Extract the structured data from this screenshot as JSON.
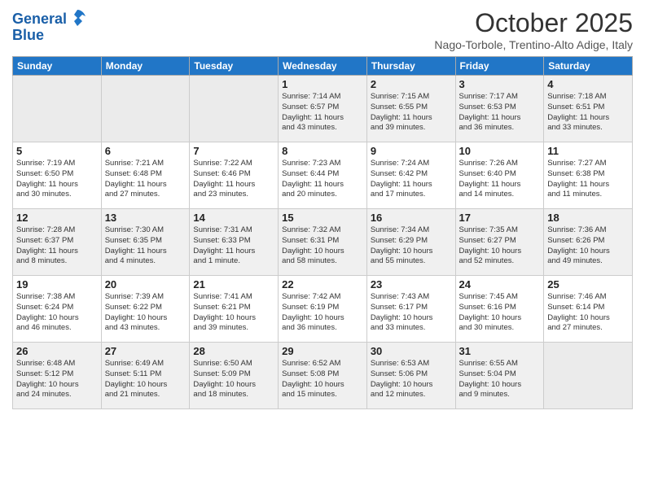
{
  "header": {
    "logo_line1": "General",
    "logo_line2": "Blue",
    "month": "October 2025",
    "location": "Nago-Torbole, Trentino-Alto Adige, Italy"
  },
  "days_of_week": [
    "Sunday",
    "Monday",
    "Tuesday",
    "Wednesday",
    "Thursday",
    "Friday",
    "Saturday"
  ],
  "weeks": [
    [
      {
        "day": "",
        "info": ""
      },
      {
        "day": "",
        "info": ""
      },
      {
        "day": "",
        "info": ""
      },
      {
        "day": "1",
        "info": "Sunrise: 7:14 AM\nSunset: 6:57 PM\nDaylight: 11 hours\nand 43 minutes."
      },
      {
        "day": "2",
        "info": "Sunrise: 7:15 AM\nSunset: 6:55 PM\nDaylight: 11 hours\nand 39 minutes."
      },
      {
        "day": "3",
        "info": "Sunrise: 7:17 AM\nSunset: 6:53 PM\nDaylight: 11 hours\nand 36 minutes."
      },
      {
        "day": "4",
        "info": "Sunrise: 7:18 AM\nSunset: 6:51 PM\nDaylight: 11 hours\nand 33 minutes."
      }
    ],
    [
      {
        "day": "5",
        "info": "Sunrise: 7:19 AM\nSunset: 6:50 PM\nDaylight: 11 hours\nand 30 minutes."
      },
      {
        "day": "6",
        "info": "Sunrise: 7:21 AM\nSunset: 6:48 PM\nDaylight: 11 hours\nand 27 minutes."
      },
      {
        "day": "7",
        "info": "Sunrise: 7:22 AM\nSunset: 6:46 PM\nDaylight: 11 hours\nand 23 minutes."
      },
      {
        "day": "8",
        "info": "Sunrise: 7:23 AM\nSunset: 6:44 PM\nDaylight: 11 hours\nand 20 minutes."
      },
      {
        "day": "9",
        "info": "Sunrise: 7:24 AM\nSunset: 6:42 PM\nDaylight: 11 hours\nand 17 minutes."
      },
      {
        "day": "10",
        "info": "Sunrise: 7:26 AM\nSunset: 6:40 PM\nDaylight: 11 hours\nand 14 minutes."
      },
      {
        "day": "11",
        "info": "Sunrise: 7:27 AM\nSunset: 6:38 PM\nDaylight: 11 hours\nand 11 minutes."
      }
    ],
    [
      {
        "day": "12",
        "info": "Sunrise: 7:28 AM\nSunset: 6:37 PM\nDaylight: 11 hours\nand 8 minutes."
      },
      {
        "day": "13",
        "info": "Sunrise: 7:30 AM\nSunset: 6:35 PM\nDaylight: 11 hours\nand 4 minutes."
      },
      {
        "day": "14",
        "info": "Sunrise: 7:31 AM\nSunset: 6:33 PM\nDaylight: 11 hours\nand 1 minute."
      },
      {
        "day": "15",
        "info": "Sunrise: 7:32 AM\nSunset: 6:31 PM\nDaylight: 10 hours\nand 58 minutes."
      },
      {
        "day": "16",
        "info": "Sunrise: 7:34 AM\nSunset: 6:29 PM\nDaylight: 10 hours\nand 55 minutes."
      },
      {
        "day": "17",
        "info": "Sunrise: 7:35 AM\nSunset: 6:27 PM\nDaylight: 10 hours\nand 52 minutes."
      },
      {
        "day": "18",
        "info": "Sunrise: 7:36 AM\nSunset: 6:26 PM\nDaylight: 10 hours\nand 49 minutes."
      }
    ],
    [
      {
        "day": "19",
        "info": "Sunrise: 7:38 AM\nSunset: 6:24 PM\nDaylight: 10 hours\nand 46 minutes."
      },
      {
        "day": "20",
        "info": "Sunrise: 7:39 AM\nSunset: 6:22 PM\nDaylight: 10 hours\nand 43 minutes."
      },
      {
        "day": "21",
        "info": "Sunrise: 7:41 AM\nSunset: 6:21 PM\nDaylight: 10 hours\nand 39 minutes."
      },
      {
        "day": "22",
        "info": "Sunrise: 7:42 AM\nSunset: 6:19 PM\nDaylight: 10 hours\nand 36 minutes."
      },
      {
        "day": "23",
        "info": "Sunrise: 7:43 AM\nSunset: 6:17 PM\nDaylight: 10 hours\nand 33 minutes."
      },
      {
        "day": "24",
        "info": "Sunrise: 7:45 AM\nSunset: 6:16 PM\nDaylight: 10 hours\nand 30 minutes."
      },
      {
        "day": "25",
        "info": "Sunrise: 7:46 AM\nSunset: 6:14 PM\nDaylight: 10 hours\nand 27 minutes."
      }
    ],
    [
      {
        "day": "26",
        "info": "Sunrise: 6:48 AM\nSunset: 5:12 PM\nDaylight: 10 hours\nand 24 minutes."
      },
      {
        "day": "27",
        "info": "Sunrise: 6:49 AM\nSunset: 5:11 PM\nDaylight: 10 hours\nand 21 minutes."
      },
      {
        "day": "28",
        "info": "Sunrise: 6:50 AM\nSunset: 5:09 PM\nDaylight: 10 hours\nand 18 minutes."
      },
      {
        "day": "29",
        "info": "Sunrise: 6:52 AM\nSunset: 5:08 PM\nDaylight: 10 hours\nand 15 minutes."
      },
      {
        "day": "30",
        "info": "Sunrise: 6:53 AM\nSunset: 5:06 PM\nDaylight: 10 hours\nand 12 minutes."
      },
      {
        "day": "31",
        "info": "Sunrise: 6:55 AM\nSunset: 5:04 PM\nDaylight: 10 hours\nand 9 minutes."
      },
      {
        "day": "",
        "info": ""
      }
    ]
  ]
}
